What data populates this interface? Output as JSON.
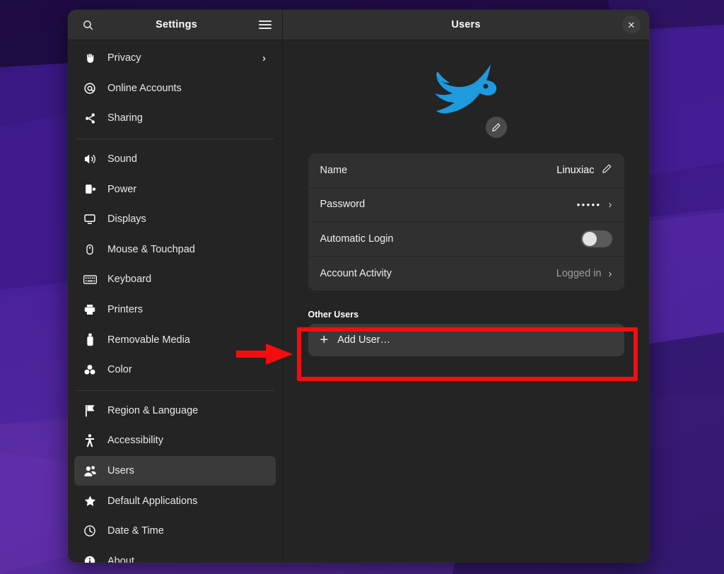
{
  "window": {
    "sidebar_title": "Settings",
    "content_title": "Users",
    "search_icon": "search-icon",
    "menu_icon": "hamburger-menu-icon",
    "close_icon": "close-icon",
    "close_label": "✕"
  },
  "sidebar": {
    "groups": [
      {
        "items": [
          {
            "label": "Privacy",
            "icon": "hand-privacy-icon",
            "glyph": "privacy",
            "chevron": "›",
            "selected": false
          },
          {
            "label": "Online Accounts",
            "icon": "at-sign-icon",
            "glyph": "at",
            "chevron": "",
            "selected": false
          },
          {
            "label": "Sharing",
            "icon": "share-nodes-icon",
            "glyph": "share",
            "chevron": "",
            "selected": false
          }
        ]
      },
      {
        "items": [
          {
            "label": "Sound",
            "icon": "speaker-icon",
            "glyph": "sound",
            "chevron": "",
            "selected": false
          },
          {
            "label": "Power",
            "icon": "power-plug-icon",
            "glyph": "power",
            "chevron": "",
            "selected": false
          },
          {
            "label": "Displays",
            "icon": "monitor-icon",
            "glyph": "display",
            "chevron": "",
            "selected": false
          },
          {
            "label": "Mouse & Touchpad",
            "icon": "mouse-icon",
            "glyph": "mouse",
            "chevron": "",
            "selected": false
          },
          {
            "label": "Keyboard",
            "icon": "keyboard-icon",
            "glyph": "keyboard",
            "chevron": "",
            "selected": false
          },
          {
            "label": "Printers",
            "icon": "printer-icon",
            "glyph": "printer",
            "chevron": "",
            "selected": false
          },
          {
            "label": "Removable Media",
            "icon": "usb-drive-icon",
            "glyph": "usb",
            "chevron": "",
            "selected": false
          },
          {
            "label": "Color",
            "icon": "color-profile-icon",
            "glyph": "color",
            "chevron": "",
            "selected": false
          }
        ]
      },
      {
        "items": [
          {
            "label": "Region & Language",
            "icon": "flag-icon",
            "glyph": "flag",
            "chevron": "",
            "selected": false
          },
          {
            "label": "Accessibility",
            "icon": "accessibility-person-icon",
            "glyph": "accessibility",
            "chevron": "",
            "selected": false
          },
          {
            "label": "Users",
            "icon": "users-group-icon",
            "glyph": "users",
            "chevron": "",
            "selected": true
          },
          {
            "label": "Default Applications",
            "icon": "star-icon",
            "glyph": "star",
            "chevron": "",
            "selected": false
          },
          {
            "label": "Date & Time",
            "icon": "clock-icon",
            "glyph": "clock",
            "chevron": "",
            "selected": false
          },
          {
            "label": "About",
            "icon": "info-circle-icon",
            "glyph": "info",
            "chevron": "",
            "selected": false
          }
        ]
      }
    ]
  },
  "content": {
    "avatar": {
      "icon": "bird-avatar-image",
      "color": "#1e9ade",
      "edit_icon": "pencil-edit-icon"
    },
    "account_card": {
      "rows": [
        {
          "label": "Name",
          "value": "Linuxiac",
          "control": "edit-pencil"
        },
        {
          "label": "Password",
          "value": "•••••",
          "control": "chevron"
        },
        {
          "label": "Automatic Login",
          "value": "",
          "control": "toggle",
          "toggle_on": false
        },
        {
          "label": "Account Activity",
          "value": "Logged in",
          "control": "chevron"
        }
      ]
    },
    "other_users": {
      "section_label": "Other Users",
      "add_user_label": "Add User…",
      "add_user_icon": "plus-icon"
    }
  },
  "annotations": {
    "highlight_color": "#f40d0d",
    "arrow_name": "red-pointer-arrow",
    "box_name": "red-highlight-box"
  }
}
